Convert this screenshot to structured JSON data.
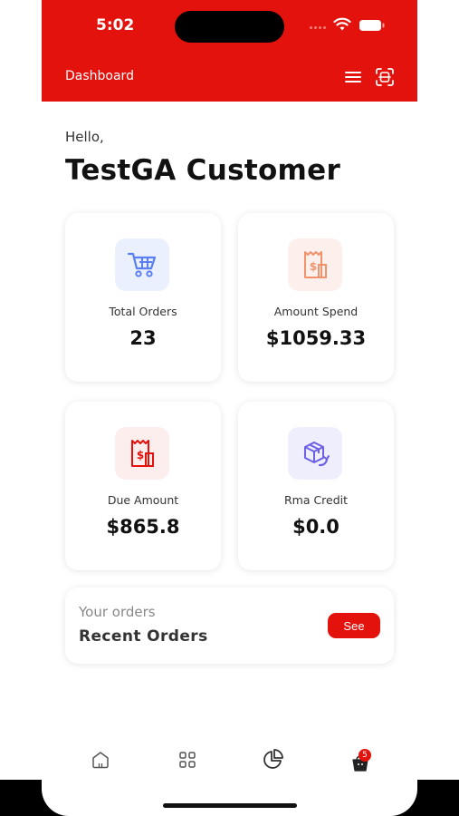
{
  "status": {
    "time": "5:02"
  },
  "header": {
    "title": "Dashboard"
  },
  "greeting": {
    "hello": "Hello,",
    "name": "TestGA Customer"
  },
  "cards": [
    {
      "label": "Total Orders",
      "value": "23",
      "icon": "cart-icon",
      "icon_bg": "#eaf0fd",
      "icon_color": "#5b7ff0"
    },
    {
      "label": "Amount Spend",
      "value": "$1059.33",
      "icon": "receipt-icon",
      "icon_bg": "#fdf0ec",
      "icon_color": "#f0936c"
    },
    {
      "label": "Due Amount",
      "value": "$865.8",
      "icon": "receipt-icon",
      "icon_bg": "#fdeeee",
      "icon_color": "#e3120c"
    },
    {
      "label": "Rma Credit",
      "value": "$0.0",
      "icon": "box-return-icon",
      "icon_bg": "#eeeefd",
      "icon_color": "#6d5fe6"
    }
  ],
  "orders": {
    "subtitle": "Your orders",
    "title": "Recent Orders",
    "see_label": "See"
  },
  "bottom_nav": {
    "items": [
      "home-icon",
      "grid-icon",
      "pie-chart-icon",
      "cart-icon"
    ],
    "cart_badge": "5"
  },
  "colors": {
    "brand": "#e3120c"
  }
}
